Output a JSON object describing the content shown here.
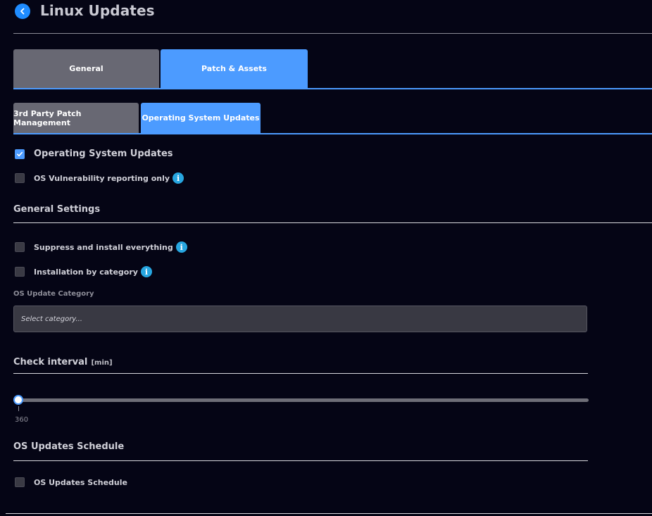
{
  "header": {
    "title": "Linux Updates"
  },
  "tabs": [
    {
      "label": "General",
      "active": false
    },
    {
      "label": "Patch & Assets",
      "active": true
    }
  ],
  "subtabs": [
    {
      "label": "3rd Party Patch Management",
      "active": false
    },
    {
      "label": "Operating System Updates",
      "active": true
    }
  ],
  "os_updates": {
    "enable_label": "Operating System Updates",
    "enable_checked": true,
    "vuln_label": "OS Vulnerability reporting only",
    "vuln_checked": false
  },
  "general_settings": {
    "title": "General Settings",
    "suppress_label": "Suppress and install everything",
    "suppress_checked": false,
    "by_category_label": "Installation by category",
    "by_category_checked": false,
    "category_field_label": "OS Update Category",
    "category_placeholder": "Select category..."
  },
  "check_interval": {
    "title": "Check interval",
    "unit": "[min]",
    "value": "360"
  },
  "schedule": {
    "title": "OS Updates Schedule",
    "checkbox_label": "OS Updates Schedule",
    "checked": false
  },
  "icons": {
    "back": "chevron-left-icon",
    "info": "info-icon",
    "check": "checkmark-icon"
  },
  "colors": {
    "background": "#050515",
    "accent": "#4c9bff",
    "tab_inactive": "#686873",
    "info": "#27a6e0"
  }
}
